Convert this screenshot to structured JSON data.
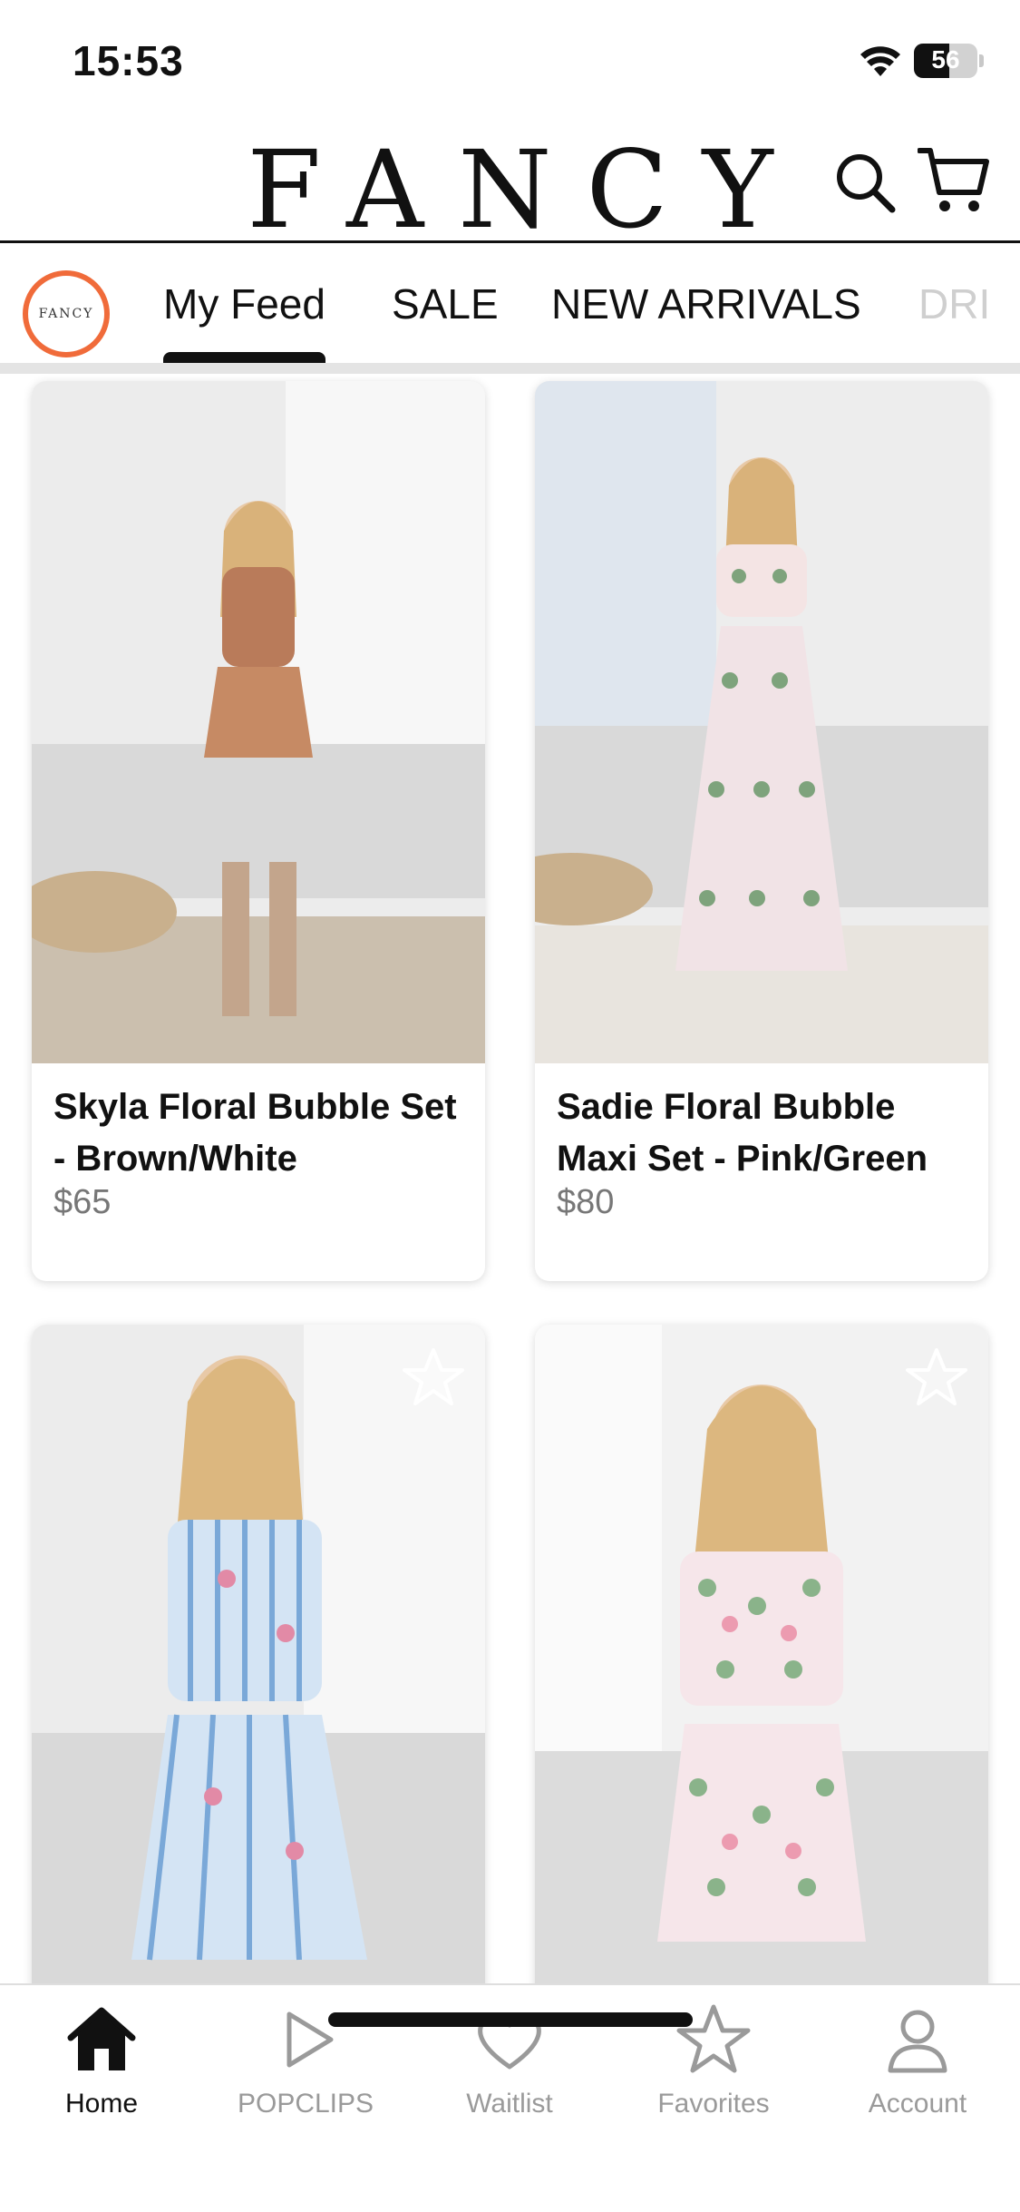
{
  "status_bar": {
    "time": "15:53",
    "battery": "56",
    "battery_level": 0.56
  },
  "header": {
    "brand": "FANCY"
  },
  "tabs": {
    "logo_text": "FANCY",
    "items": [
      {
        "label": "My Feed",
        "active": true
      },
      {
        "label": "SALE"
      },
      {
        "label": "NEW ARRIVALS"
      },
      {
        "label": "DRI"
      }
    ]
  },
  "products": [
    {
      "name": "Skyla Floral Bubble Set - Brown/White",
      "price": "$65",
      "colors": [
        "#b97b5a",
        "#f1e6da"
      ]
    },
    {
      "name": "Sadie Floral Bubble Maxi Set - Pink/Green",
      "price": "$80",
      "colors": [
        "#f4e4e4",
        "#7ea37c"
      ]
    },
    {
      "name": "",
      "price": "",
      "colors": [
        "#d4e4f4",
        "#7aa8d8"
      ]
    },
    {
      "name": "",
      "price": "",
      "colors": [
        "#f6e6ea",
        "#8ab38a"
      ]
    }
  ],
  "tabbar": {
    "items": [
      {
        "label": "Home",
        "icon": "home-icon",
        "active": true
      },
      {
        "label": "POPCLIPS",
        "icon": "play-icon"
      },
      {
        "label": "Waitlist",
        "icon": "heart-icon"
      },
      {
        "label": "Favorites",
        "icon": "star-icon"
      },
      {
        "label": "Account",
        "icon": "person-icon"
      }
    ]
  }
}
